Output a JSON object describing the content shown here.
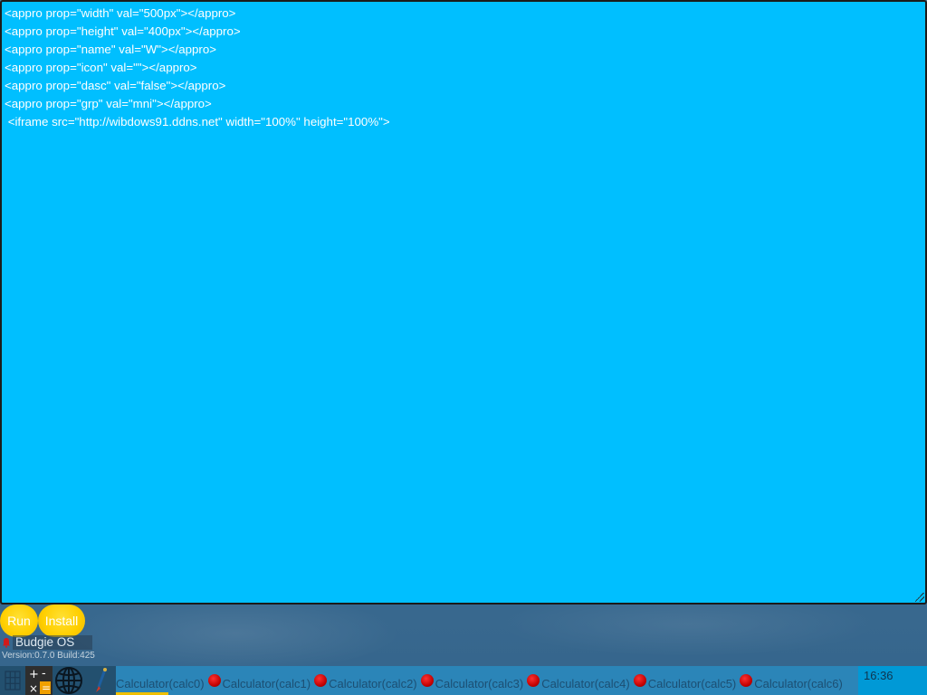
{
  "editor": {
    "lines": [
      "<appro prop=\"width\" val=\"500px\"></appro>",
      "<appro prop=\"height\" val=\"400px\"></appro>",
      "<appro prop=\"name\" val=\"W\"></appro>",
      "<appro prop=\"icon\" val=\"\"></appro>",
      "<appro prop=\"dasc\" val=\"false\"></appro>",
      "<appro prop=\"grp\" val=\"mni\"></appro>",
      " <iframe src=\"http://wibdows91.ddns.net\" width=\"100%\" height=\"100%\">"
    ],
    "background_color": "#00bfff"
  },
  "buttons": {
    "run_label": "Run",
    "install_label": "Install"
  },
  "os": {
    "name": "Budgie OS",
    "version": "Version:0.7.0  Build:425"
  },
  "taskbar": {
    "icons": [
      "grid-icon",
      "calculator-icon",
      "globe-icon",
      "brush-icon"
    ],
    "tasks": [
      "Calculator(calc0)",
      "Calculator(calc1)",
      "Calculator(calc2)",
      "Calculator(calc3)",
      "Calculator(calc4)",
      "Calculator(calc5)",
      "Calculator(calc6)"
    ],
    "clock": "16:36"
  }
}
